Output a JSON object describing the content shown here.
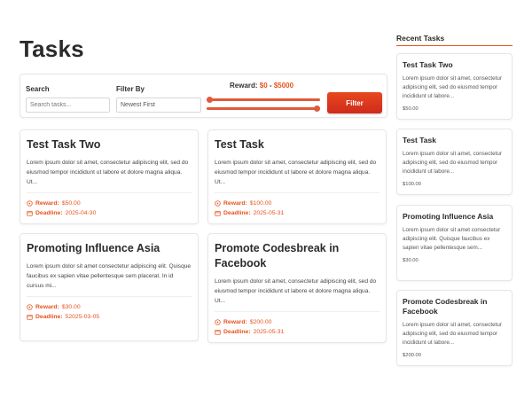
{
  "page": {
    "title": "Tasks"
  },
  "filters": {
    "search_label": "Search",
    "search_placeholder": "Search tasks...",
    "filter_by_label": "Filter By",
    "filter_by_value": "Newest First",
    "reward_label_prefix": "Reward: ",
    "reward_min": "$0",
    "reward_sep": " - ",
    "reward_max": "$5000",
    "filter_button": "Filter",
    "accent_color": "#e8531e"
  },
  "tasks": [
    {
      "title": "Test Task Two",
      "description": "Lorem ipsum dolor sit amet, consectetur adipiscing elit, sed do eiusmod tempor incididunt ut labore et dolore magna aliqua. Ut...",
      "reward_label": "Reward:",
      "reward": "$50.00",
      "deadline_label": "Deadline:",
      "deadline": "2025-04-30"
    },
    {
      "title": "Test Task",
      "description": "Lorem ipsum dolor sit amet, consectetur adipiscing elit, sed do eiusmod tempor incididunt ut labore et dolore magna aliqua. Ut...",
      "reward_label": "Reward:",
      "reward": "$100.00",
      "deadline_label": "Deadline:",
      "deadline": "2025-05-31"
    },
    {
      "title": "Promoting Influence Asia",
      "description": "Lorem ipsum dolor sit amet consectetur adipiscing elit. Quisque faucibus ex sapien vitae pellentesque sem placerat. In id cursus mi...",
      "reward_label": "Reward:",
      "reward": "$30.00",
      "deadline_label": "Deadline:",
      "deadline": "52025-03-05"
    },
    {
      "title": "Promote Codesbreak in Facebook",
      "description": "Lorem ipsum dolor sit amet, consectetur adipiscing elit, sed do eiusmod tempor incididunt ut labore et dolore magna aliqua. Ut...",
      "reward_label": "Reward:",
      "reward": "$200.00",
      "deadline_label": "Deadline:",
      "deadline": "2025-05-31"
    }
  ],
  "sidebar": {
    "title": "Recent Tasks",
    "items": [
      {
        "title": "Test Task Two",
        "description": "Lorem ipsum dolor sit amet, consectetur adipiscing elit, sed do eiusmod tempor incididunt ut labore...",
        "reward": "$50.00"
      },
      {
        "title": "Test Task",
        "description": "Lorem ipsum dolor sit amet, consectetur adipiscing elit, sed do eiusmod tempor incididunt ut labore...",
        "reward": "$100.00"
      },
      {
        "title": "Promoting Influence Asia",
        "description": "Lorem ipsum dolor sit amet consectetur adipiscing elit. Quisque faucibus ex sapien vitae pellentesque sem...",
        "reward": "$30.00"
      },
      {
        "title": "Promote Codesbreak in Facebook",
        "description": "Lorem ipsum dolor sit amet, consectetur adipiscing elit, sed do eiusmod tempor incididunt ut labore...",
        "reward": "$200.00"
      }
    ]
  },
  "icons": {
    "reward": "dollar-circle-icon",
    "deadline": "calendar-icon"
  }
}
